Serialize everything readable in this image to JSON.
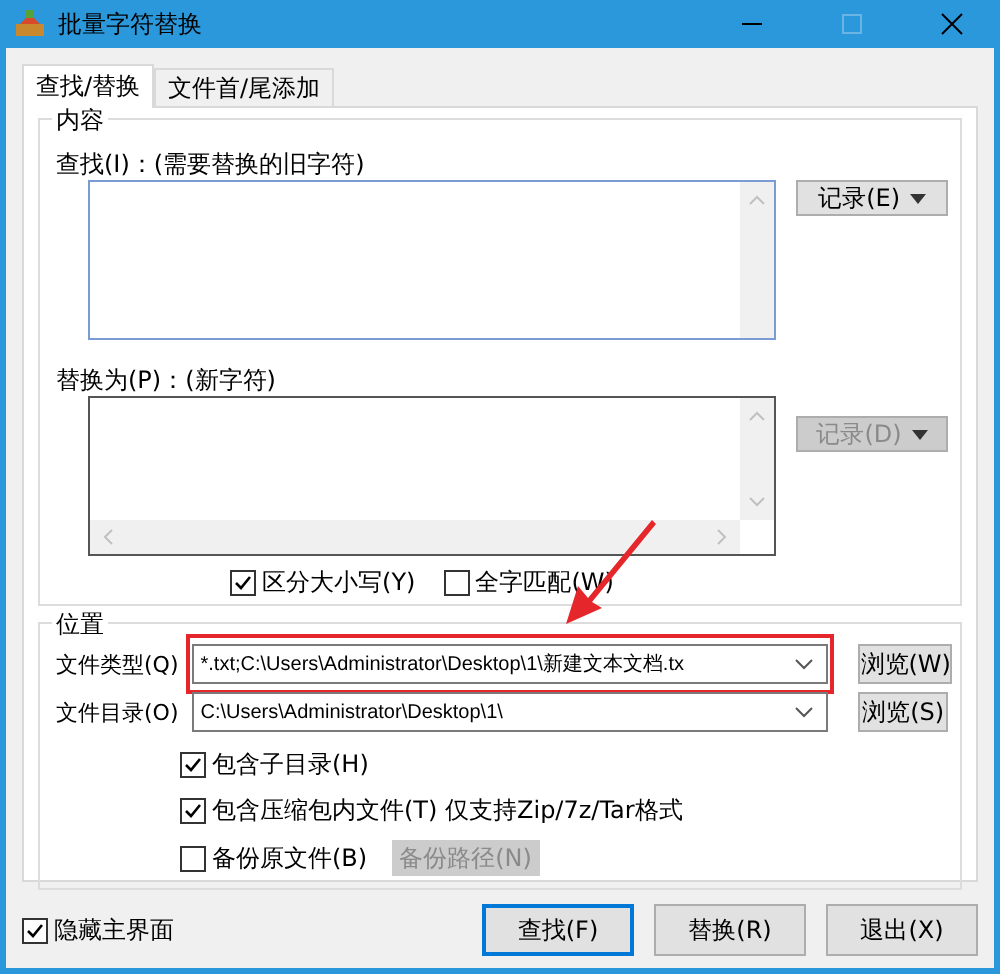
{
  "window": {
    "title": "批量字符替换"
  },
  "tabs": [
    {
      "label": "查找/替换",
      "selected": true
    },
    {
      "label": "文件首/尾添加",
      "selected": false
    }
  ],
  "content_group": {
    "title": "内容",
    "find": {
      "label": "查找(I)：(需要替换的旧字符)",
      "history_button": {
        "label": "记录(E)",
        "disabled": false
      }
    },
    "replace": {
      "label": "替换为(P)：(新字符)",
      "history_button": {
        "label": "记录(D)",
        "disabled": true
      }
    },
    "options": [
      {
        "label": "区分大小写(Y)",
        "checked": true
      },
      {
        "label": "全字匹配(W)",
        "checked": false
      }
    ]
  },
  "location_group": {
    "title": "位置",
    "file_type": {
      "label": "文件类型(Q)",
      "value": "*.txt;C:\\Users\\Administrator\\Desktop\\1\\新建文本文档.tx",
      "browse": "浏览(W)",
      "highlighted": true
    },
    "directory": {
      "label": "文件目录(O)",
      "value": "C:\\Users\\Administrator\\Desktop\\1\\",
      "browse": "浏览(S)"
    },
    "options": [
      {
        "label": "包含子目录(H)",
        "checked": true
      },
      {
        "label": "包含压缩包内文件(T) 仅支持Zip/7z/Tar格式",
        "checked": true
      },
      {
        "label": "备份原文件(B)",
        "checked": false,
        "button": {
          "label": "备份路径(N)",
          "disabled": true
        }
      }
    ]
  },
  "hide_main": {
    "label": "隐藏主界面",
    "checked": true
  },
  "buttons": [
    {
      "label": "查找(F)",
      "default": true
    },
    {
      "label": "替换(R)",
      "default": false
    },
    {
      "label": "退出(X)",
      "default": false
    }
  ]
}
